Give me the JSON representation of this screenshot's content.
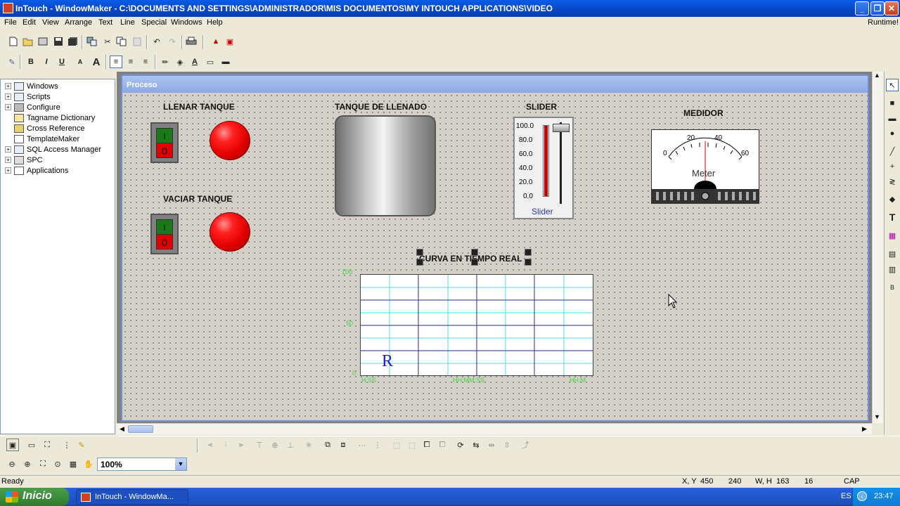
{
  "window": {
    "title": "InTouch - WindowMaker - C:\\DOCUMENTS AND SETTINGS\\ADMINISTRADOR\\MIS DOCUMENTOS\\MY INTOUCH APPLICATIONS\\VIDEO",
    "min_label": "_",
    "max_label": "❐",
    "close_label": "✕"
  },
  "menu": {
    "items": [
      "File",
      "Edit",
      "View",
      "Arrange",
      "Text",
      "Line",
      "Special",
      "Windows",
      "Help"
    ],
    "runtime": "Runtime!"
  },
  "format_toolbar": {
    "bold": "B",
    "italic": "I",
    "underline": "U",
    "font_smaller": "A",
    "font_larger": "A",
    "text_color": "A"
  },
  "tree": {
    "items": [
      {
        "label": "Windows",
        "expandable": true
      },
      {
        "label": "Scripts",
        "expandable": true
      },
      {
        "label": "Configure",
        "expandable": true
      },
      {
        "label": "Tagname Dictionary",
        "expandable": false
      },
      {
        "label": "Cross Reference",
        "expandable": false
      },
      {
        "label": "TemplateMaker",
        "expandable": false
      },
      {
        "label": "SQL Access Manager",
        "expandable": true
      },
      {
        "label": "SPC",
        "expandable": true
      },
      {
        "label": "Applications",
        "expandable": true
      }
    ]
  },
  "process_window": {
    "title": "Proceso",
    "fill_label": "LLENAR TANQUE",
    "empty_label": "VACIAR TANQUE",
    "tank_label": "TANQUE DE LLENADO",
    "slider_label": "SLIDER",
    "meter_label": "MEDIDOR",
    "trend_label": "CURVA EN TIEMPO REAL",
    "switch_on": "I",
    "switch_off": "0"
  },
  "slider": {
    "ticks": [
      "100.0",
      "80.0",
      "60.0",
      "40.0",
      "20.0",
      "0.0"
    ],
    "caption": "Slider",
    "level": 100
  },
  "meter": {
    "scale": [
      "0",
      "20",
      "40",
      "60"
    ],
    "caption": "Meter"
  },
  "trend": {
    "y_ticks": [
      "100",
      "50",
      "0"
    ],
    "x_ticks": [
      "H:SS",
      "HH:MM:SS",
      "HH:M"
    ],
    "marker": "R"
  },
  "zoom": {
    "value": "100%"
  },
  "status": {
    "text": "Ready",
    "xy_label": "X, Y",
    "x": "450",
    "y": "240",
    "wh_label": "W, H",
    "w": "163",
    "h": "16",
    "cap": "CAP"
  },
  "taskbar": {
    "start": "Inicio",
    "task": "InTouch - WindowMa...",
    "lang": "ES",
    "clock": "23:47"
  }
}
